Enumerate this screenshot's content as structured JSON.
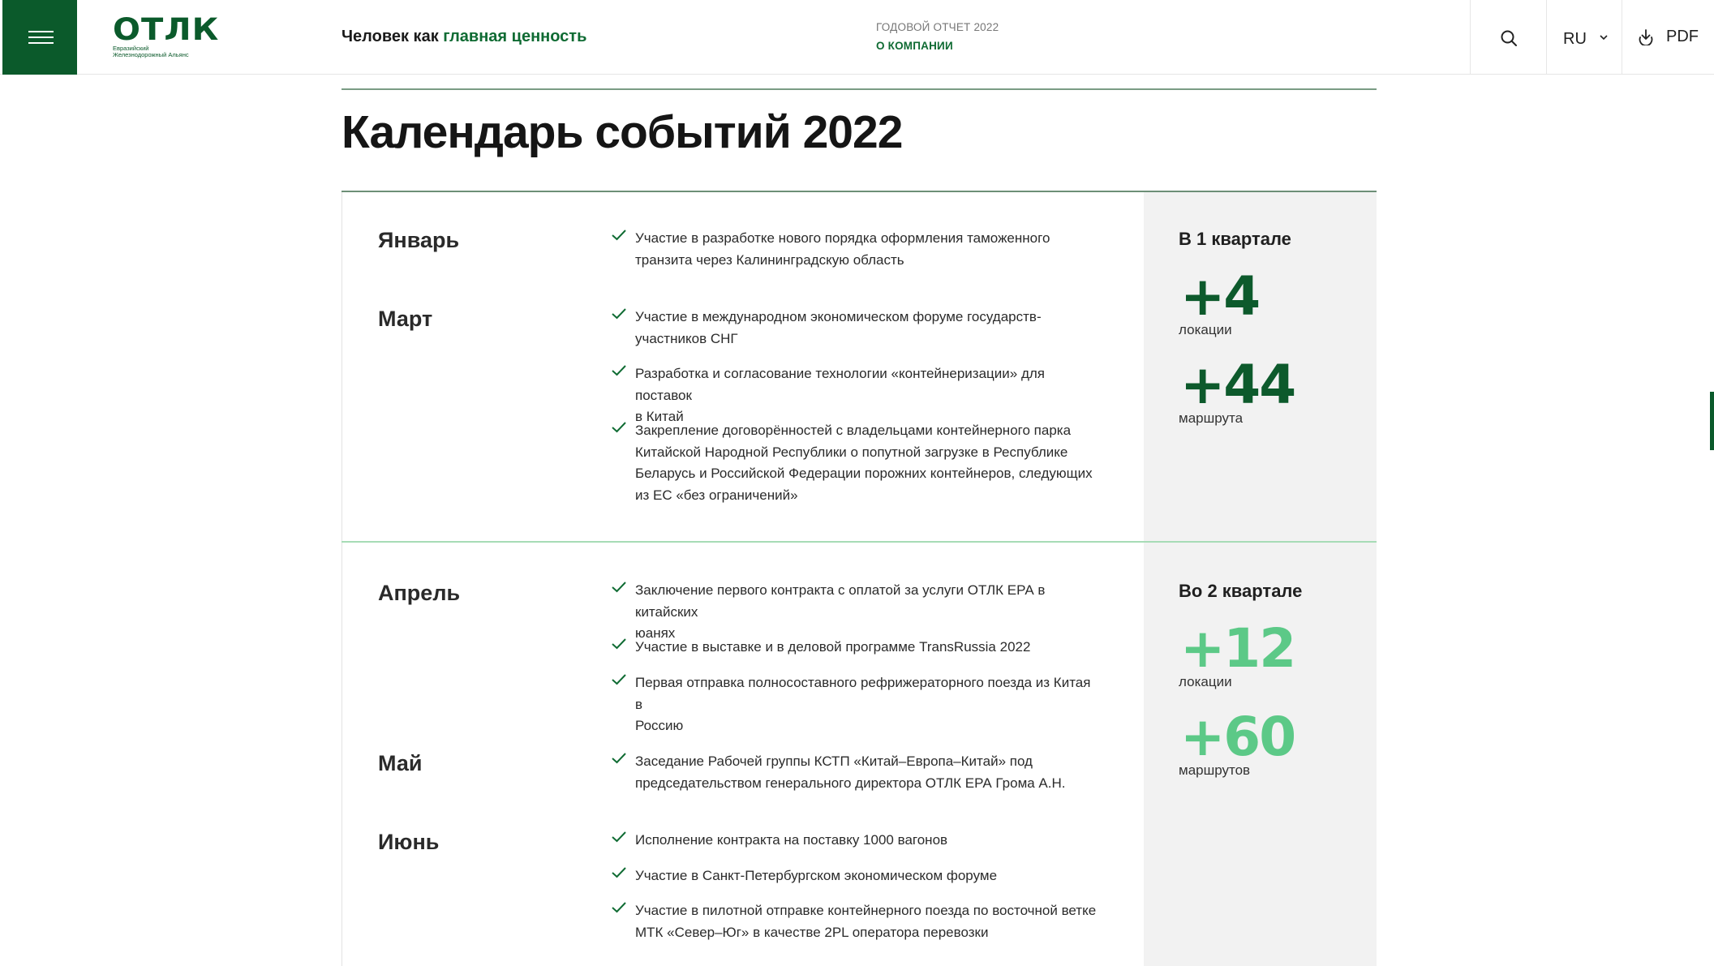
{
  "header": {
    "logo": {
      "word": "ОТЛК",
      "sub1": "Евразийский",
      "sub2": "Железнодорожный Альянс"
    },
    "tagline_prefix": "Человек как ",
    "tagline_accent": "главная ценность",
    "annual_report": "ГОДОВОЙ ОТЧЕТ 2022",
    "section_link": "О КОМПАНИИ",
    "language": "RU",
    "pdf_label": "PDF"
  },
  "page_title": "Календарь событий 2022",
  "sections": [
    {
      "quarter_title": "В 1 квартале",
      "stats": [
        {
          "value": "+4",
          "caption": "локации"
        },
        {
          "value": "+44",
          "caption": "маршрута"
        }
      ],
      "months": [
        {
          "name": "Январь",
          "items": [
            {
              "lines": [
                "Участие в разработке нового порядка оформления таможенного",
                "транзита через Калининградскую область"
              ]
            }
          ]
        },
        {
          "name": "Март",
          "items": [
            {
              "lines": [
                "Участие в международном экономическом форуме государств-",
                "участников СНГ"
              ]
            },
            {
              "lines": [
                "Разработка и согласование технологии «контейнеризации» для поставок",
                "в Китай"
              ]
            },
            {
              "lines": [
                "Закрепление договорённостей с владельцами контейнерного парка",
                "Китайской Народной Республики о попутной загрузке в Республике",
                "Беларусь и Российской Федерации порожних контейнеров, следующих",
                "из ЕС «без ограничений»"
              ]
            }
          ]
        }
      ]
    },
    {
      "quarter_title": "Во 2 квартале",
      "stats": [
        {
          "value": "+12",
          "caption": "локации"
        },
        {
          "value": "+60",
          "caption": "маршрутов"
        }
      ],
      "months": [
        {
          "name": "Апрель",
          "items": [
            {
              "lines": [
                "Заключение первого контракта с оплатой за услуги ОТЛК ЕРА в китайских",
                "юанях"
              ]
            },
            {
              "lines": [
                "Участие в выставке и в деловой программе TransRussia 2022"
              ]
            },
            {
              "lines": [
                "Первая отправка полносоставного рефрижераторного поезда из Китая в",
                "Россию"
              ]
            }
          ]
        },
        {
          "name": "Май",
          "items": [
            {
              "lines": [
                "Заседание Рабочей группы КСТП «Китай–Европа–Китай» под",
                "председательством генерального директора ОТЛК ЕРА Грома А.Н."
              ]
            }
          ]
        },
        {
          "name": "Июнь",
          "items": [
            {
              "lines": [
                "Исполнение контракта на поставку 1000 вагонов"
              ]
            },
            {
              "lines": [
                "Участие в Санкт-Петербургском экономическом форуме"
              ]
            },
            {
              "lines": [
                "Участие в пилотной отправке контейнерного поезда по восточной ветке",
                "МТК «Север–Юг» в качестве 2PL оператора перевозки"
              ]
            }
          ]
        }
      ]
    }
  ],
  "colors": {
    "brand_dark": "#0b5a2b",
    "accent_green": "#0f6b33",
    "light_green": "#5cc987",
    "panel_gray": "#f2f2f2"
  }
}
